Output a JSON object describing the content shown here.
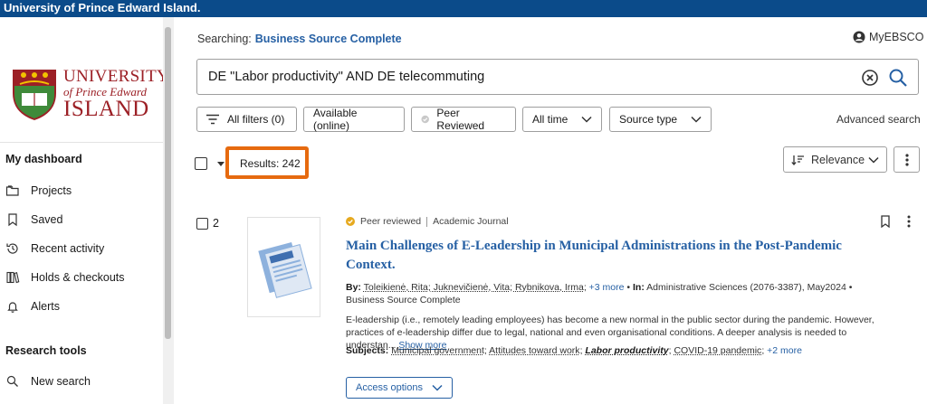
{
  "banner": {
    "title": "University of Prince Edward Island."
  },
  "logo": {
    "line1": "UNIVERSITY",
    "line2": "of Prince Edward",
    "line3": "ISLAND"
  },
  "sidebar": {
    "heading_dashboard": "My dashboard",
    "items": [
      {
        "label": "Projects",
        "icon": "folder-icon"
      },
      {
        "label": "Saved",
        "icon": "bookmark-icon"
      },
      {
        "label": "Recent activity",
        "icon": "history-icon"
      },
      {
        "label": "Holds & checkouts",
        "icon": "books-icon"
      },
      {
        "label": "Alerts",
        "icon": "bell-icon"
      }
    ],
    "heading_tools": "Research tools",
    "tools": [
      {
        "label": "New search",
        "icon": "search-icon"
      }
    ]
  },
  "header": {
    "searching_label": "Searching:",
    "database": "Business Source Complete",
    "account": "MyEBSCO"
  },
  "search": {
    "query": "DE \"Labor productivity\" AND DE telecommuting"
  },
  "filters": {
    "all_filters": "All filters (0)",
    "available_online": "Available (online)",
    "peer_reviewed": "Peer Reviewed",
    "all_time": "All time",
    "source_type": "Source type",
    "advanced_search": "Advanced search"
  },
  "results": {
    "count_label": "Results: 242",
    "sort": "Relevance"
  },
  "result": {
    "number": "2",
    "peer_reviewed": "Peer reviewed",
    "type": "Academic Journal",
    "title": "Main Challenges of E-Leadership in Municipal Administrations in the Post-Pandemic Context.",
    "by_label": "By:",
    "authors": "Toleikienė, Rita; Juknevičienė, Vita; Rybnikova, Irma;",
    "more_authors": "+3 more",
    "in_label": "In:",
    "source": "Administrative Sciences (2076-3387), May2024 • Business Source Complete",
    "abstract": "E-leadership (i.e., remotely leading employees) has become a new normal in the public sector during the pandemic. However, practices of e-leadership differ due to legal, national and even organisational conditions. A deeper analysis is needed to understan...",
    "show_more": "Show more",
    "subjects_label": "Subjects:",
    "subject_1": "Municipal government",
    "subject_2": "Attitudes toward work",
    "subject_3": "Labor productivity",
    "subject_4": "COVID-19 pandemic",
    "more_subjects": "+2 more",
    "access_options": "Access options"
  },
  "colors": {
    "banner": "#0b4b8a",
    "link": "#2660a4",
    "highlight": "#e66a0f",
    "logo_red": "#9c2026"
  }
}
